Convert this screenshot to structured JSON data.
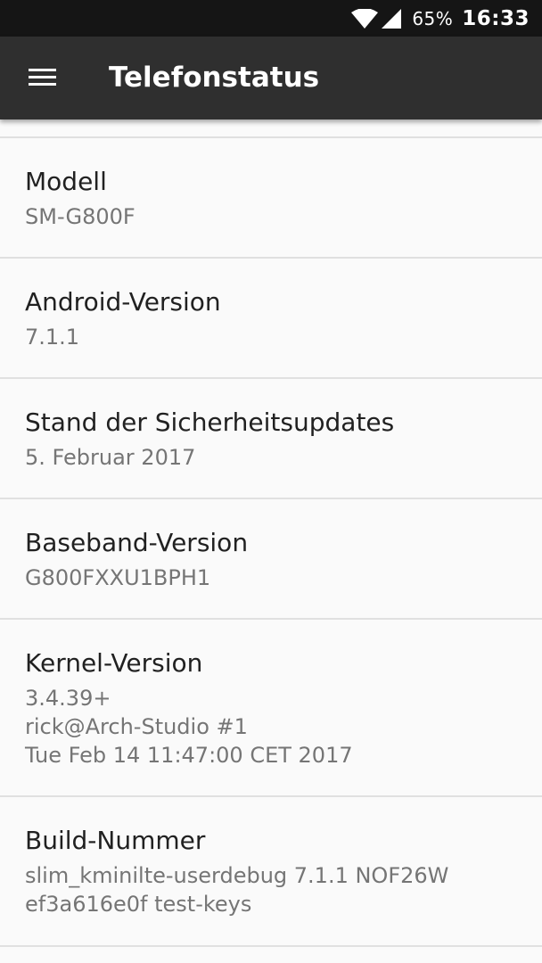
{
  "status_bar": {
    "battery": "65%",
    "time": "16:33",
    "icons": [
      "wifi-icon",
      "cellular-signal-icon"
    ]
  },
  "toolbar": {
    "menu_icon": "menu-icon",
    "title": "Telefonstatus"
  },
  "items": [
    {
      "title": "Modell",
      "summary": "SM-G800F"
    },
    {
      "title": "Android-Version",
      "summary": "7.1.1"
    },
    {
      "title": "Stand der Sicherheitsupdates",
      "summary": "5. Februar 2017"
    },
    {
      "title": "Baseband-Version",
      "summary": "G800FXXU1BPH1"
    },
    {
      "title": "Kernel-Version",
      "summary": "3.4.39+\nrick@Arch-Studio #1\nTue Feb 14 11:47:00 CET 2017"
    },
    {
      "title": "Build-Nummer",
      "summary": "slim_kminilte-userdebug 7.1.1 NOF26W\nef3a616e0f test-keys"
    }
  ],
  "colors": {
    "status_bar": "#151515",
    "toolbar": "#2f2f2f",
    "background": "#fafafa",
    "title_text": "#212121",
    "summary_text": "#757575",
    "divider": "#e0e0e0"
  }
}
